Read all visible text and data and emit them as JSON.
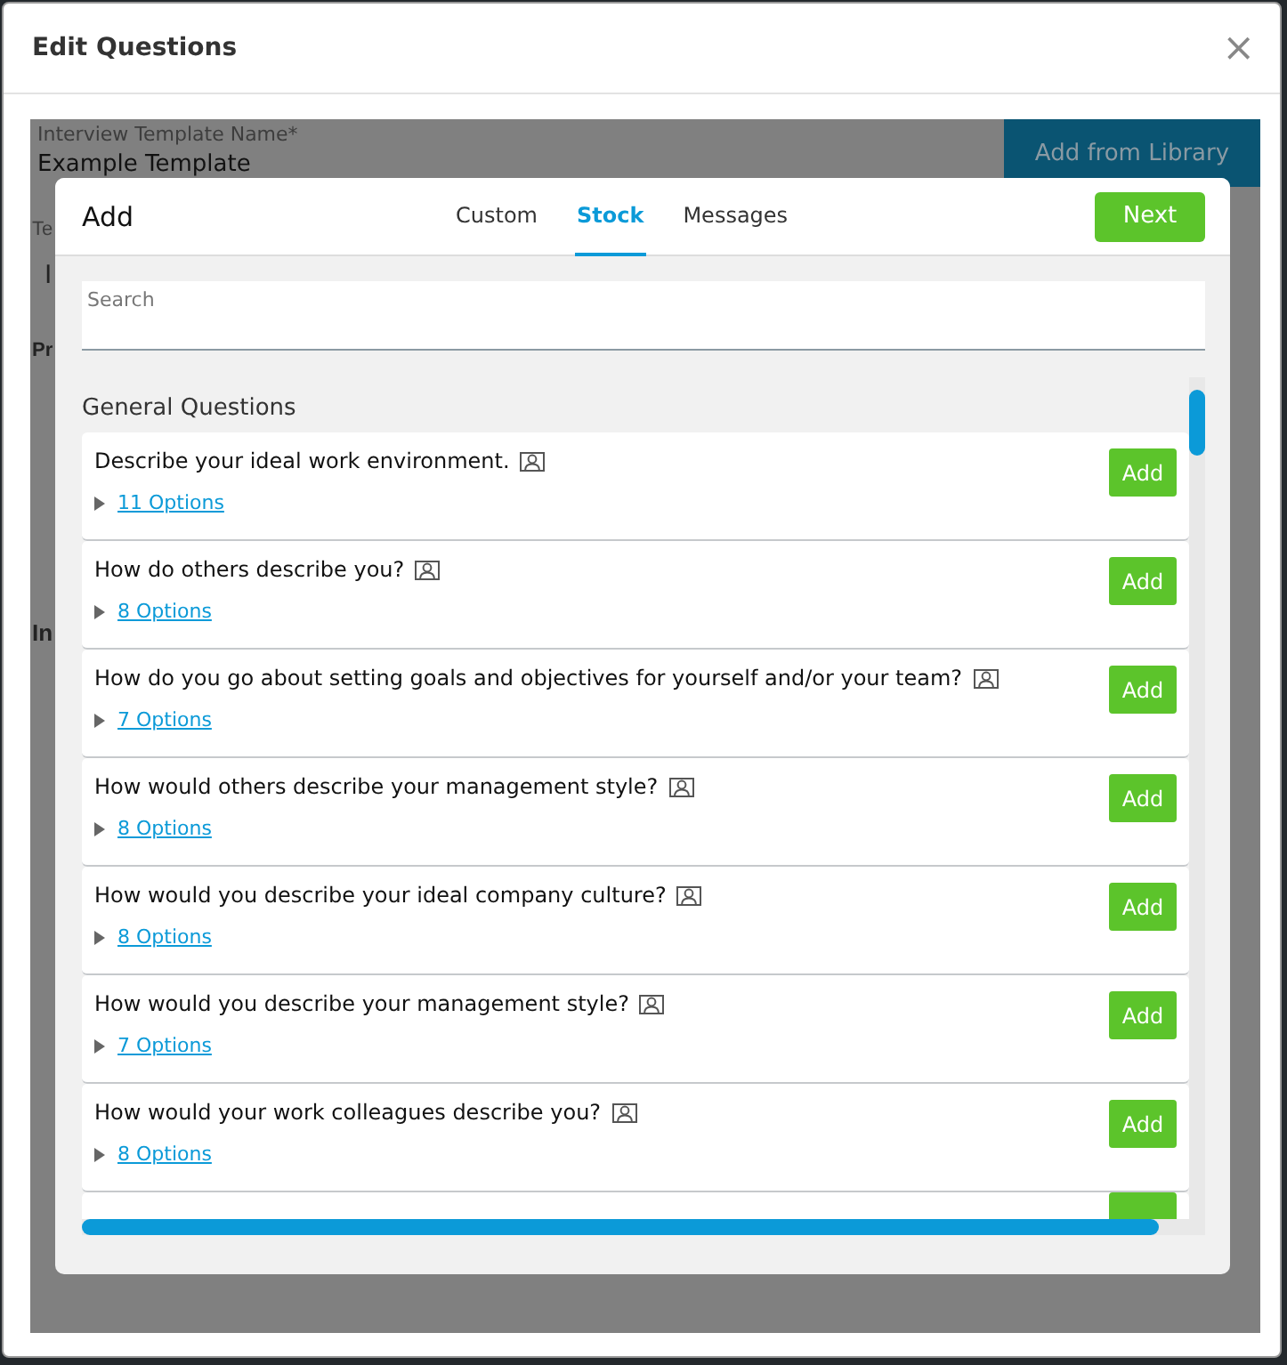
{
  "window": {
    "title": "Edit Questions",
    "close": "×"
  },
  "background_form": {
    "template_name_label": "Interview Template Name*",
    "template_name_value": "Example Template",
    "library_button": "Add from Library",
    "fragments": [
      "Te",
      "I",
      "Pr",
      "In"
    ]
  },
  "dialog": {
    "title": "Add",
    "tabs": [
      {
        "label": "Custom",
        "selected": false
      },
      {
        "label": "Stock",
        "selected": true
      },
      {
        "label": "Messages",
        "selected": false
      }
    ],
    "next_button": "Next",
    "search": {
      "placeholder": "Search"
    },
    "section_title": "General Questions",
    "questions": [
      {
        "text": "Describe your ideal work environment.",
        "options": "11 Options",
        "button": "Add"
      },
      {
        "text": "How do others describe you?",
        "options": "8 Options",
        "button": "Add"
      },
      {
        "text": "How do you go about setting goals and objectives for yourself and/or your team?",
        "options": "7 Options",
        "button": "Add"
      },
      {
        "text": "How would others describe your management style?",
        "options": "8 Options",
        "button": "Add"
      },
      {
        "text": "How would you describe your ideal company culture?",
        "options": "8 Options",
        "button": "Add"
      },
      {
        "text": "How would you describe your management style?",
        "options": "7 Options",
        "button": "Add"
      },
      {
        "text": "How would your work colleagues describe you?",
        "options": "8 Options",
        "button": "Add"
      }
    ]
  }
}
